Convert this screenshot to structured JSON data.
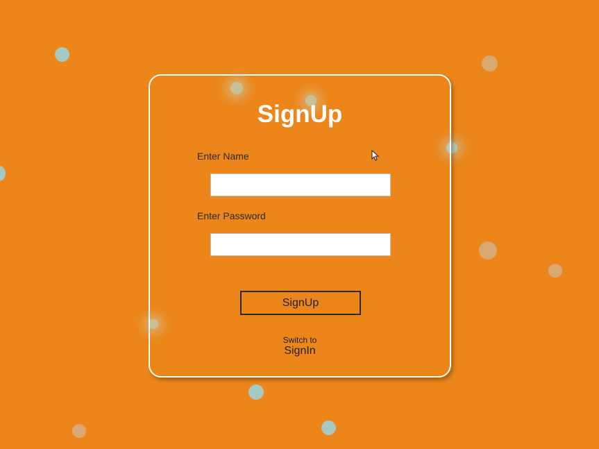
{
  "form": {
    "title": "SignUp",
    "name_label": "Enter Name",
    "name_value": "",
    "password_label": "Enter Password",
    "password_value": "",
    "submit_label": "SignUp",
    "switch_hint": "Switch to",
    "switch_link": "SignIn"
  },
  "colors": {
    "background": "#ec861a",
    "card_border": "#ffffff",
    "title": "#ffffff",
    "particle_teal": "#a6c9c4",
    "particle_tan": "#d9a873"
  },
  "icons": {
    "cursor": "mouse-pointer-icon"
  }
}
